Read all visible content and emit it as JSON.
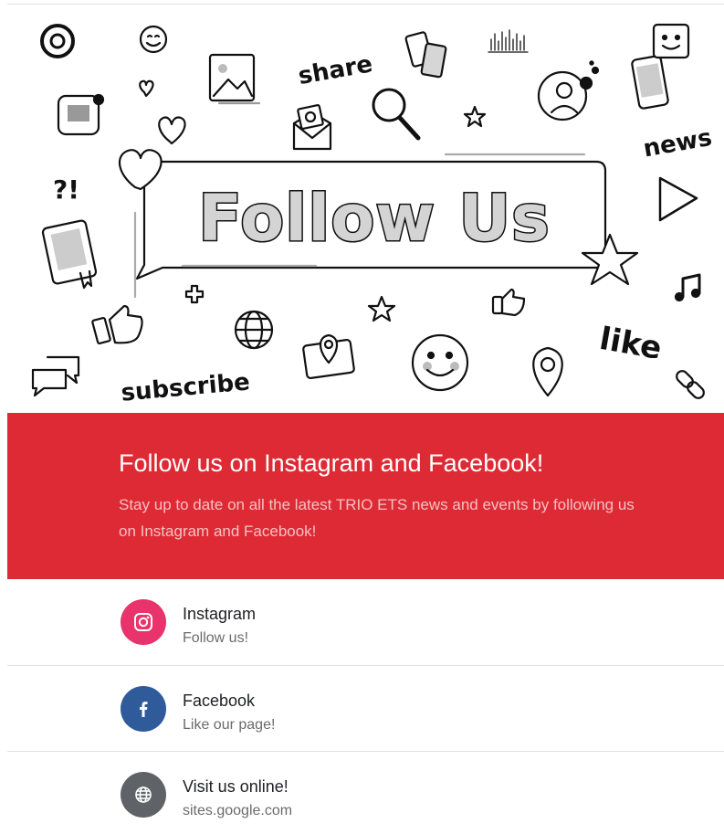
{
  "banner": {
    "headline": "Follow Us",
    "doodle_words": {
      "share": "share",
      "news": "news",
      "interrobang": "?!",
      "like": "like",
      "subscribe": "subscribe",
      "at": "@"
    }
  },
  "hero": {
    "title": "Follow us on Instagram and Facebook!",
    "subtitle": "Stay up to date on all the latest TRIO ETS news and events by following us on Instagram and Facebook!",
    "background_color": "#de2a34"
  },
  "links": [
    {
      "title": "Instagram",
      "subtitle": "Follow us!",
      "icon": "instagram-icon",
      "color": "#e8336d"
    },
    {
      "title": "Facebook",
      "subtitle": "Like our page!",
      "icon": "facebook-icon",
      "color": "#2f5b9a"
    },
    {
      "title": "Visit us online!",
      "subtitle": "sites.google.com",
      "icon": "globe-icon",
      "color": "#5f6368"
    }
  ]
}
